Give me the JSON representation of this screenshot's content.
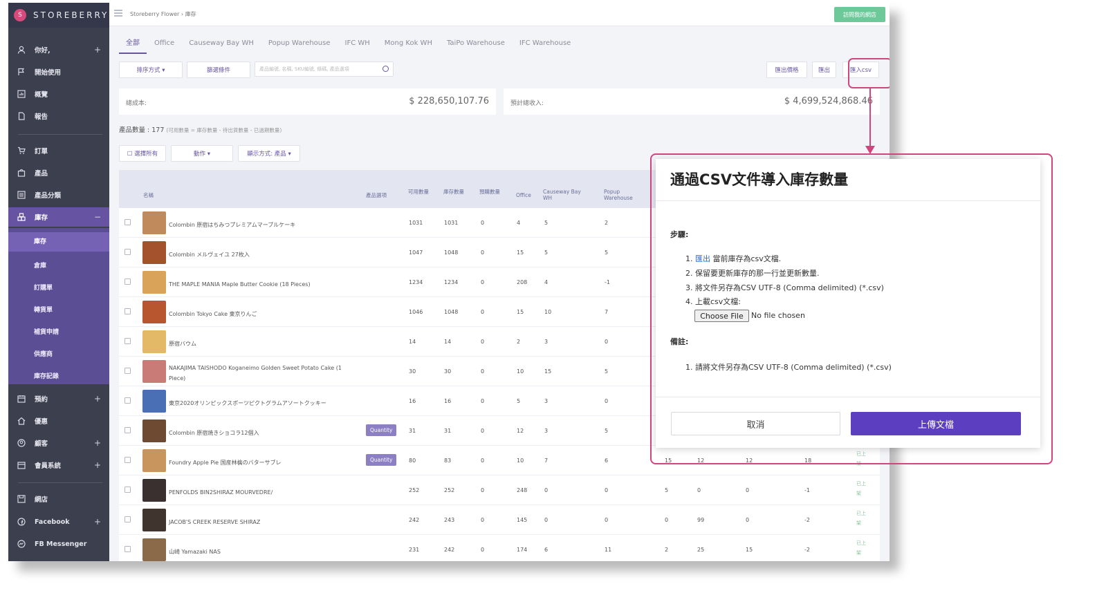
{
  "brand": {
    "name": "STOREBERRY",
    "logo_glyph": "S"
  },
  "sidebar": {
    "items": [
      {
        "label": "你好,",
        "plus": "+"
      },
      {
        "label": "開始使用"
      },
      {
        "label": "概覽"
      },
      {
        "label": "報告"
      },
      {
        "label": "訂單"
      },
      {
        "label": "產品"
      },
      {
        "label": "產品分類"
      },
      {
        "label": "庫存",
        "plus": "−"
      },
      {
        "label": "預約",
        "plus": "+"
      },
      {
        "label": "優惠"
      },
      {
        "label": "顧客",
        "plus": "+"
      },
      {
        "label": "會員系統",
        "plus": "+"
      },
      {
        "label": "網店"
      },
      {
        "label": "Facebook",
        "plus": "+"
      },
      {
        "label": "FB Messenger"
      }
    ],
    "inventory_sub": [
      "庫存",
      "倉庫",
      "訂購單",
      "轉貨單",
      "補貨申請",
      "供應商",
      "庫存記錄"
    ]
  },
  "topbar": {
    "breadcrumb": "Storeberry Flower  ›  庫存",
    "visit_store": "訪問我的網店"
  },
  "tabs": [
    "全部",
    "Office",
    "Causeway Bay WH",
    "Popup Warehouse",
    "IFC WH",
    "Mong Kok WH",
    "TaiPo Warehouse",
    "IFC Warehouse"
  ],
  "toolbar": {
    "sort": "排序方式 ▾",
    "filter": "篩選條件",
    "search_placeholder": "產品編號, 名稱, SKU編號, 條碼, 產品選項",
    "export_price": "匯出價格",
    "export": "匯出",
    "import_csv": "匯入csv"
  },
  "summary": {
    "cost_label": "總成本:",
    "cost_value": "$ 228,650,107.76",
    "revenue_label": "預計總收入:",
    "revenue_value": "$ 4,699,524,868.46"
  },
  "counts": {
    "label": "產品數量 : 177",
    "note": "(可用數量 = 庫存數量 - 待出貨數量 - 已過期數量)"
  },
  "list_toolbar": {
    "select_all": "☐ 選擇所有",
    "actions": "動作 ▾",
    "display": "顯示方式: 產品 ▾"
  },
  "table": {
    "headers": {
      "name": "名稱",
      "options": "產品選項",
      "available": "可用數量",
      "stock": "庫存數量",
      "reserved": "預購數量",
      "office": "Office",
      "causeway": "Causeway Bay WH",
      "popup": "Popup Warehouse"
    },
    "rows": [
      {
        "name": "Colombin 原宿はちみつプレミアムマーブルケーキ",
        "opt": "",
        "avail": "1031",
        "stock": "1031",
        "res": "0",
        "office": "4",
        "cwb": "5",
        "popup": "2",
        "x1": "",
        "x2": "",
        "x3": "",
        "x4": "",
        "status": "",
        "thumb": "#c08a5c"
      },
      {
        "name": "Colombin メルヴェイユ 27枚入",
        "opt": "",
        "avail": "1047",
        "stock": "1048",
        "res": "0",
        "office": "15",
        "cwb": "5",
        "popup": "5",
        "x1": "",
        "x2": "",
        "x3": "",
        "x4": "",
        "status": "",
        "thumb": "#a4512e"
      },
      {
        "name": "THE MAPLE MANIA Maple Butter Cookie (18 Pieces)",
        "opt": "",
        "avail": "1234",
        "stock": "1234",
        "res": "0",
        "office": "208",
        "cwb": "4",
        "popup": "-1",
        "x1": "",
        "x2": "",
        "x3": "",
        "x4": "",
        "status": "",
        "thumb": "#d9a45a"
      },
      {
        "name": "Colombin Tokyo Cake 東京りんご",
        "opt": "",
        "avail": "1046",
        "stock": "1048",
        "res": "0",
        "office": "15",
        "cwb": "10",
        "popup": "7",
        "x1": "",
        "x2": "",
        "x3": "",
        "x4": "",
        "status": "",
        "thumb": "#b8562f"
      },
      {
        "name": "原宿バウム",
        "opt": "",
        "avail": "14",
        "stock": "14",
        "res": "0",
        "office": "2",
        "cwb": "3",
        "popup": "0",
        "x1": "",
        "x2": "",
        "x3": "",
        "x4": "",
        "status": "",
        "thumb": "#e3b866"
      },
      {
        "name": "NAKAJIMA TAISHODO Koganeimo Golden Sweet Potato Cake (1 Piece)",
        "opt": "",
        "avail": "30",
        "stock": "30",
        "res": "0",
        "office": "10",
        "cwb": "15",
        "popup": "5",
        "x1": "",
        "x2": "",
        "x3": "",
        "x4": "",
        "status": "",
        "thumb": "#c97b78"
      },
      {
        "name": "東京2020オリンピックスポーツピクトグラムアソートクッキー",
        "opt": "",
        "avail": "16",
        "stock": "16",
        "res": "0",
        "office": "5",
        "cwb": "3",
        "popup": "0",
        "x1": "",
        "x2": "",
        "x3": "",
        "x4": "",
        "status": "",
        "thumb": "#4a6fb5"
      },
      {
        "name": "Colombin 原宿焼きショコラ12個入",
        "opt": "Quantity",
        "avail": "31",
        "stock": "31",
        "res": "0",
        "office": "12",
        "cwb": "3",
        "popup": "5",
        "x1": "",
        "x2": "",
        "x3": "",
        "x4": "",
        "status": "",
        "thumb": "#6e4a32"
      },
      {
        "name": "Foundry Apple Pie 国産林檎のバターサブレ",
        "opt": "Quantity",
        "avail": "80",
        "stock": "83",
        "res": "0",
        "office": "10",
        "cwb": "7",
        "popup": "6",
        "x1": "15",
        "x2": "12",
        "x3": "12",
        "x4": "18",
        "status": "已上架",
        "thumb": "#c9955e"
      },
      {
        "name": "PENFOLDS BIN2SHIRAZ MOURVEDRE/",
        "opt": "",
        "avail": "252",
        "stock": "252",
        "res": "0",
        "office": "248",
        "cwb": "0",
        "popup": "0",
        "x1": "5",
        "x2": "0",
        "x3": "0",
        "x4": "-1",
        "status": "已上架",
        "thumb": "#3a3030"
      },
      {
        "name": "JACOB'S CREEK RESERVE SHIRAZ",
        "opt": "",
        "avail": "242",
        "stock": "243",
        "res": "0",
        "office": "145",
        "cwb": "0",
        "popup": "0",
        "x1": "0",
        "x2": "99",
        "x3": "0",
        "x4": "-2",
        "status": "已上架",
        "thumb": "#40352e"
      },
      {
        "name": "山崎 Yamazaki NAS",
        "opt": "",
        "avail": "231",
        "stock": "242",
        "res": "0",
        "office": "174",
        "cwb": "6",
        "popup": "11",
        "x1": "2",
        "x2": "25",
        "x3": "15",
        "x4": "-2",
        "status": "已上架",
        "thumb": "#8a6a48"
      }
    ]
  },
  "modal": {
    "title": "通過CSV文件導入庫存數量",
    "steps_heading": "步驟:",
    "step1_link": "匯出",
    "step1_rest": " 當前庫存為csv文檔.",
    "step1_num": "1.",
    "step2": "2. 保留要更新庫存的那一行並更新數量.",
    "step3": "3. 將文件另存為CSV UTF-8 (Comma delimited) (*.csv)",
    "step4": "4. 上載csv文檔:",
    "choose_file": "Choose File",
    "no_file": "No file chosen",
    "notes_heading": "備註:",
    "note1": "1. 請將文件另存為CSV UTF-8 (Comma delimited) (*.csv)",
    "cancel": "取消",
    "upload": "上傳文檔"
  },
  "colors": {
    "accent": "#6654a3",
    "highlight": "#d0457e",
    "sidebar": "#3c3f4e",
    "upload": "#5c3fc0",
    "listed": "#8bc49c"
  }
}
